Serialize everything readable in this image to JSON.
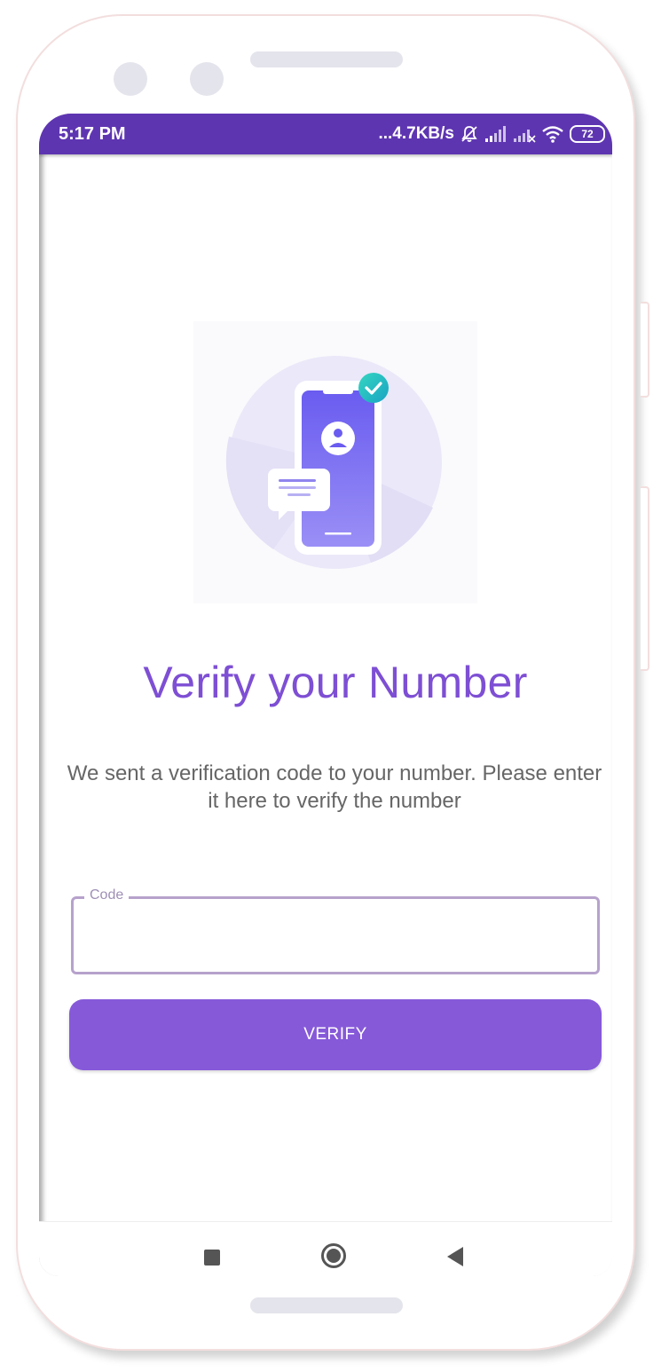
{
  "status_bar": {
    "time": "5:17 PM",
    "network_speed": "...4.7KB/s",
    "battery_level": "72",
    "icons": [
      "mute-bell-icon",
      "signal-icon",
      "signal-no-sim-icon",
      "wifi-icon",
      "battery-icon"
    ]
  },
  "verify": {
    "illustration_icon": "phone-verified-illustration",
    "title": "Verify your Number",
    "message": "We sent a verification code to your number. Please enter it here to verify the number",
    "code_field": {
      "label": "Code",
      "value": "",
      "placeholder": ""
    },
    "button_label": "VERIFY"
  },
  "nav_bar": {
    "icons": [
      "recents-icon",
      "home-icon",
      "back-icon"
    ]
  },
  "colors": {
    "status_bar": "#5e35b1",
    "accent": "#7e4fd4",
    "button": "#8659d9",
    "field_border": "#b6a2cc"
  }
}
